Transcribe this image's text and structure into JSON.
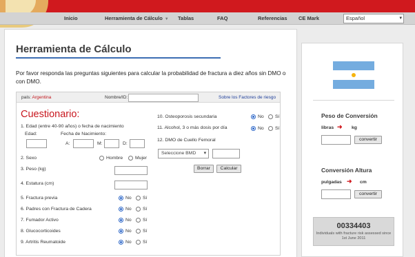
{
  "nav": {
    "items": [
      "Inicio",
      "Herramienta de Cálculo",
      "Tablas",
      "FAQ",
      "Referencias",
      "CE Mark"
    ],
    "dropdown_arrow": "▼",
    "language": "Español"
  },
  "main": {
    "title": "Herramienta de Cálculo",
    "intro": "Por favor responda las preguntas siguientes para calcular la probabilidad de fractura a diez años sin DMO o con DMO.",
    "header": {
      "pais_label": "país:",
      "pais_value": "Argentina",
      "nombre_label": "Nombre/ID:",
      "risk_link": "Sobre los Factores de riesgo"
    },
    "cuestionario": "Cuestionario:",
    "q1": {
      "label": "1. Edad (entre 40-90 años) o fecha de nacimiento",
      "edad": "Edad:",
      "fecha": "Fecha de Nacimiento:",
      "a": "A:",
      "m": "M:",
      "d": "D:"
    },
    "q2": {
      "label": "2. Sexo",
      "hombre": "Hombre",
      "mujer": "Mujer"
    },
    "q3": "3. Peso (kg)",
    "q4": "4. Estatura (cm)",
    "q5": "5. Fractura previa",
    "q6": "6. Padres con Fractura de Cadera",
    "q7": "7. Fumador Activo",
    "q8": "8. Glucocorticoides",
    "q9": "9. Artritis Reumatoide",
    "q10": "10. Osteoporosis secundaria",
    "q11": "11. Alcohol, 3 o más dosis por día",
    "q12": "12. DMO de Cuello Femoral",
    "no": "No",
    "si": "Sí",
    "bmd_select": "Seleccione BMD",
    "borrar": "Borrar",
    "calcular": "Calcular"
  },
  "side": {
    "peso_title": "Peso de Conversión",
    "libras": "libras",
    "kg": "kg",
    "altura_title": "Conversión Altura",
    "pulgadas": "pulgadas",
    "cm": "cm",
    "convertir": "convertir",
    "arrow": "➜",
    "counter": "00334403",
    "counter_text": "Individuals with fracture risk assessed since 1st June 2011"
  }
}
